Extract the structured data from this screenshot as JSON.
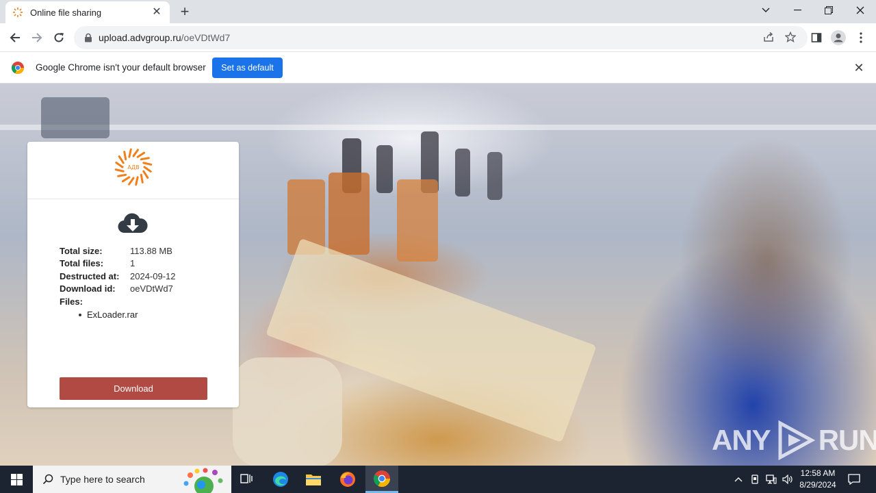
{
  "browser": {
    "tab_title": "Online file sharing",
    "url_host": "upload.advgroup.ru",
    "url_path": "/oeVDtWd7"
  },
  "infobar": {
    "message": "Google Chrome isn't your default browser",
    "button_label": "Set as default"
  },
  "card": {
    "logo_text": "АДВ",
    "rows": [
      {
        "label": "Total size:",
        "value": "113.88 MB"
      },
      {
        "label": "Total files:",
        "value": "1"
      },
      {
        "label": "Destructed at:",
        "value": "2024-09-12"
      },
      {
        "label": "Download id:",
        "value": "oeVDtWd7"
      }
    ],
    "files_label": "Files:",
    "files": [
      "ExLoader.rar"
    ],
    "download_label": "Download"
  },
  "watermark": {
    "text_left": "ANY",
    "text_right": "RUN"
  },
  "taskbar": {
    "search_placeholder": "Type here to search",
    "time": "12:58 AM",
    "date": "8/29/2024"
  },
  "colors": {
    "download_button": "#b04a43",
    "set_default_button": "#1a73e8",
    "logo_orange": "#f07f1b",
    "taskbar": "#1c2331"
  }
}
